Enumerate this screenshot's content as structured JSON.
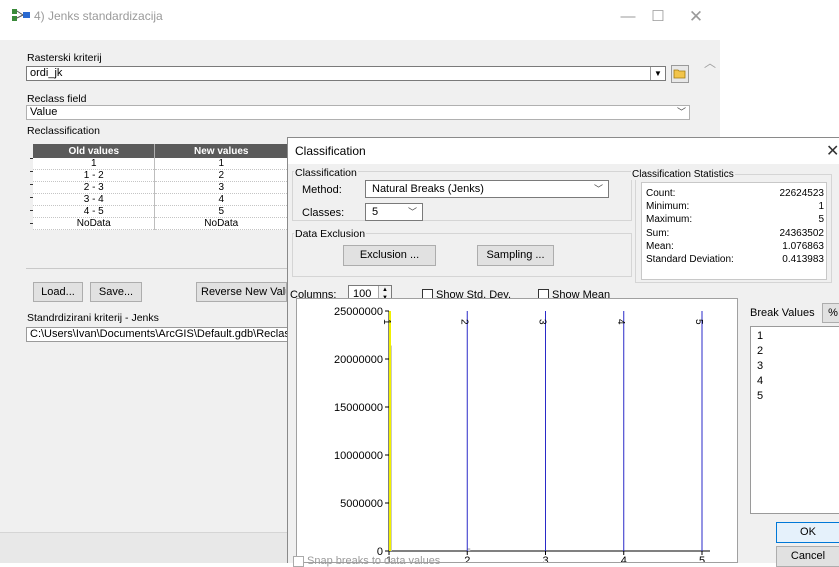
{
  "window": {
    "title": "4) Jenks standardizacija",
    "minimize": "—",
    "maximize": "☐",
    "close": "✕"
  },
  "form": {
    "raster_label": "Rasterski kriterij",
    "raster_value": "ordi_jk",
    "reclass_field_label": "Reclass field",
    "reclass_field_value": "Value",
    "reclassification_label": "Reclassification",
    "table": {
      "headers": [
        "Old values",
        "New values"
      ],
      "rows": [
        [
          "1",
          "1"
        ],
        [
          "1 - 2",
          "2"
        ],
        [
          "2 - 3",
          "3"
        ],
        [
          "3 - 4",
          "4"
        ],
        [
          "4 - 5",
          "5"
        ],
        [
          "NoData",
          "NoData"
        ]
      ]
    },
    "load_button": "Load...",
    "save_button": "Save...",
    "reverse_button": "Reverse New Values",
    "output_label": "Standrdizirani kriterij - Jenks",
    "output_value": "C:\\Users\\Ivan\\Documents\\ArcGIS\\Default.gdb\\Reclass_ordi_jk"
  },
  "dialog": {
    "title": "Classification",
    "close": "✕",
    "classification_group": "Classification",
    "method_label": "Method:",
    "method_value": "Natural Breaks (Jenks)",
    "classes_label": "Classes:",
    "classes_value": "5",
    "exclusion_group": "Data Exclusion",
    "exclusion_button": "Exclusion ...",
    "sampling_button": "Sampling ...",
    "columns_label": "Columns:",
    "columns_value": "100",
    "show_std_dev": "Show Std. Dev.",
    "show_mean": "Show Mean",
    "stats_group": "Classification Statistics",
    "stats": [
      {
        "label": "Count:",
        "value": "22624523"
      },
      {
        "label": "Minimum:",
        "value": "1"
      },
      {
        "label": "Maximum:",
        "value": "5"
      },
      {
        "label": "Sum:",
        "value": "24363502"
      },
      {
        "label": "Mean:",
        "value": "1.076863"
      },
      {
        "label": "Standard Deviation:",
        "value": "0.413983"
      }
    ],
    "break_values_label": "Break Values",
    "percent_button": "%",
    "break_values": [
      "1",
      "2",
      "3",
      "4",
      "5"
    ],
    "ok_button": "OK",
    "cancel_button": "Cancel",
    "snap_label": "Snap breaks to data values"
  },
  "chart_data": {
    "type": "bar",
    "ylim": [
      0,
      25000000
    ],
    "xlim": [
      1,
      5
    ],
    "y_ticks": [
      "25000000",
      "20000000",
      "15000000",
      "10000000",
      "5000000",
      "0"
    ],
    "x_ticks": [
      "1",
      "2",
      "3",
      "4",
      "5"
    ],
    "histogram": [
      {
        "x": 1,
        "count": 21400000
      },
      {
        "x": 2,
        "count": 300000
      }
    ],
    "break_lines": [
      1,
      2,
      3,
      4,
      5
    ],
    "break_line_labels": [
      "1",
      "2",
      "3",
      "4",
      "5"
    ],
    "colors": {
      "histogram": "#c8c8c8",
      "first_break": "#f0f000",
      "break": "#2a2ac8"
    }
  }
}
